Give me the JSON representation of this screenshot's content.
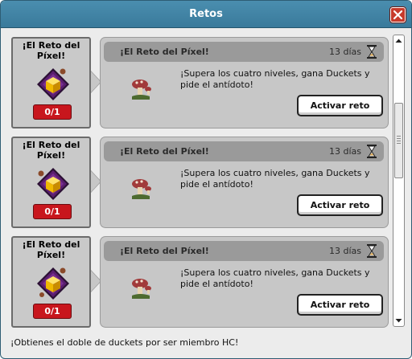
{
  "window": {
    "title": "Retos"
  },
  "challenges": [
    {
      "card_title": "¡El Reto del Píxel!",
      "progress": "0/1",
      "header_title": "¡El Reto del Píxel!",
      "days": "13 días",
      "description": "¡Supera los cuatro niveles, gana Duckets y pide el antídoto!",
      "button": "Activar reto"
    },
    {
      "card_title": "¡El Reto del Píxel!",
      "progress": "0/1",
      "header_title": "¡El Reto del Píxel!",
      "days": "13 días",
      "description": "¡Supera los cuatro niveles, gana Duckets y pide el antídoto!",
      "button": "Activar reto"
    },
    {
      "card_title": "¡El Reto del Píxel!",
      "progress": "0/1",
      "header_title": "¡El Reto del Píxel!",
      "days": "13 días",
      "description": "¡Supera los cuatro niveles, gana Duckets y pide el antídoto!",
      "button": "Activar reto"
    }
  ],
  "footer": {
    "text": "¡Obtienes el doble de duckets por ser miembro HC!"
  },
  "icons": {
    "close": "close-icon",
    "badge": "pixel-challenge-badge-icon",
    "mushroom": "mushroom-icon",
    "hourglass": "hourglass-icon",
    "scroll_up": "scroll-up-arrow-icon",
    "scroll_down": "scroll-down-arrow-icon"
  },
  "colors": {
    "titlebar": "#3f82a3",
    "progress_badge": "#c8161d",
    "badge_purple": "#5a1e6e",
    "badge_gold": "#f0b800"
  }
}
